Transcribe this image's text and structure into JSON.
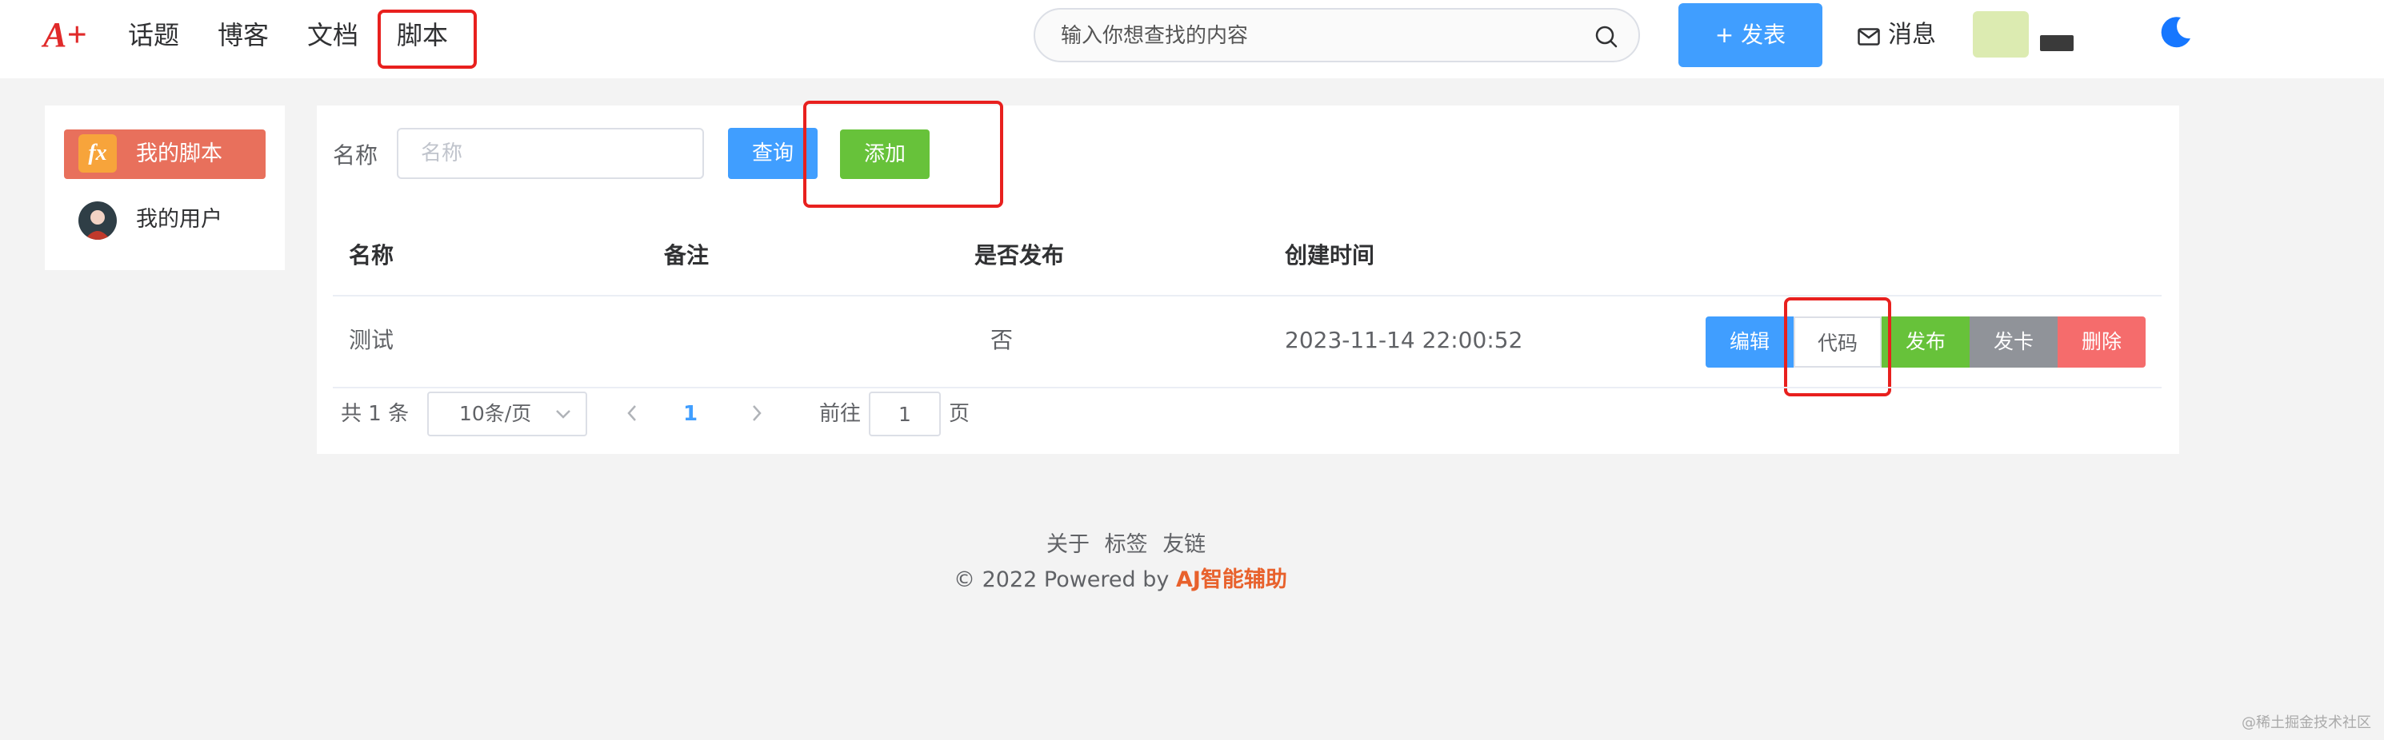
{
  "header": {
    "logo": "A+",
    "nav": [
      "话题",
      "博客",
      "文档",
      "脚本"
    ],
    "active_nav": "脚本",
    "search_placeholder": "输入你想查找的内容",
    "publish_label": "发表",
    "messages_label": "消息"
  },
  "sidebar": {
    "items": [
      {
        "label": "我的脚本",
        "icon": "fx-icon",
        "active": true
      },
      {
        "label": "我的用户",
        "icon": "user-avatar",
        "active": false
      }
    ]
  },
  "filter": {
    "name_label": "名称",
    "name_placeholder": "名称",
    "name_value": "",
    "query_label": "查询",
    "add_label": "添加"
  },
  "table": {
    "columns": [
      "名称",
      "备注",
      "是否发布",
      "创建时间"
    ],
    "rows": [
      {
        "name": "测试",
        "remark": "",
        "published": "否",
        "created": "2023-11-14 22:00:52",
        "actions": [
          "编辑",
          "代码",
          "发布",
          "发卡",
          "删除"
        ]
      }
    ]
  },
  "pagination": {
    "total": "共 1 条",
    "page_size": "10条/页",
    "current_page": "1",
    "goto_label": "前往",
    "goto_value": "1",
    "page_suffix": "页"
  },
  "footer": {
    "links": [
      "关于",
      "标签",
      "友链"
    ],
    "copyright": "© 2022 Powered by",
    "brand": "AJ智能辅助"
  },
  "watermark": "@稀土掘金技术社区",
  "colors": {
    "primary": "#409eff",
    "success": "#67c23a",
    "info": "#909399",
    "danger": "#f56c6c",
    "sidebar_active": "#e8705c",
    "highlight_box": "#e8201e",
    "brand": "#e8612c"
  }
}
